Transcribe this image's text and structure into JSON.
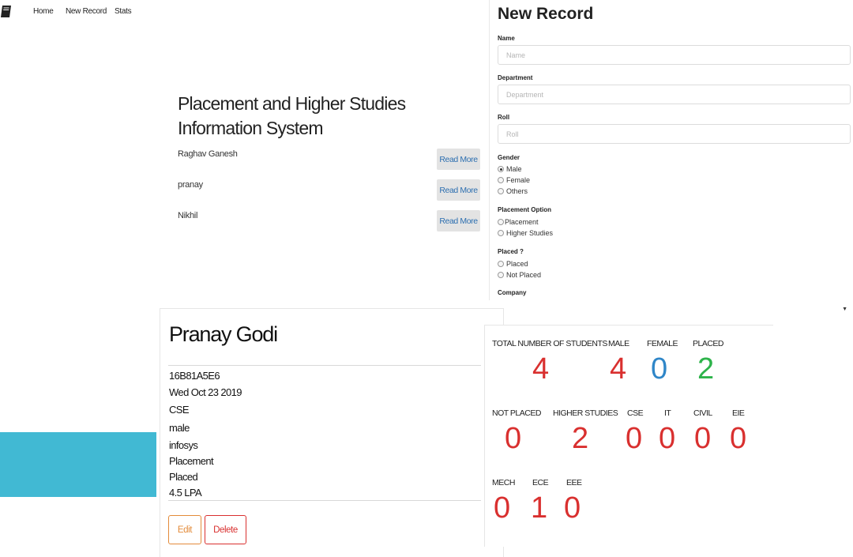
{
  "nav": {
    "logo_icon": "book-icon",
    "links": [
      "Home",
      "New Record",
      "Stats"
    ]
  },
  "main": {
    "title": "Placement and Higher Studies Information System",
    "students": [
      {
        "name": "Raghav Ganesh",
        "action": "Read More"
      },
      {
        "name": "pranay",
        "action": "Read More"
      },
      {
        "name": "Nikhil",
        "action": "Read More"
      }
    ]
  },
  "new_record": {
    "title": "New Record",
    "name_label": "Name",
    "name_placeholder": "Name",
    "department_label": "Department",
    "department_placeholder": "Department",
    "roll_label": "Roll",
    "roll_placeholder": "Roll",
    "gender_label": "Gender",
    "gender_options": [
      "Male",
      "Female",
      "Others"
    ],
    "gender_selected": "Male",
    "placement_option_label": "Placement Option",
    "placement_options": [
      "Placement",
      "Higher Studies"
    ],
    "placed_label": "Placed ?",
    "placed_options": [
      "Placed",
      "Not Placed"
    ],
    "company_label": "Company",
    "company_value": ""
  },
  "detail": {
    "name": "Pranay Godi",
    "lines": [
      "16B81A5E6",
      "Wed Oct 23 2019",
      "CSE",
      "male",
      "infosys",
      "Placement",
      "Placed",
      "4.5 LPA"
    ],
    "edit_label": "Edit",
    "delete_label": "Delete"
  },
  "stats": {
    "rows": [
      [
        {
          "label": "TOTAL NUMBER OF STUDENTS",
          "value": "4",
          "color": "#d9302f"
        },
        {
          "label": "MALE",
          "value": "4",
          "color": "#d9302f"
        },
        {
          "label": "FEMALE",
          "value": "0",
          "color": "#2f86c8"
        },
        {
          "label": "PLACED",
          "value": "2",
          "color": "#2db34a"
        }
      ],
      [
        {
          "label": "NOT PLACED",
          "value": "0",
          "color": "#d9302f"
        },
        {
          "label": "HIGHER STUDIES",
          "value": "2",
          "color": "#d9302f"
        },
        {
          "label": "CSE",
          "value": "0",
          "color": "#d9302f"
        },
        {
          "label": "IT",
          "value": "0",
          "color": "#d9302f"
        },
        {
          "label": "CIVIL",
          "value": "0",
          "color": "#d9302f"
        },
        {
          "label": "EIE",
          "value": "0",
          "color": "#d9302f"
        }
      ],
      [
        {
          "label": "MECH",
          "value": "0",
          "color": "#d9302f"
        },
        {
          "label": "ECE",
          "value": "1",
          "color": "#d9302f"
        },
        {
          "label": "EEE",
          "value": "0",
          "color": "#d9302f"
        }
      ]
    ]
  },
  "colors": {
    "teal_block": "#41b9d3",
    "link_blue": "#2d6fb0",
    "edit_orange": "#e38b3a",
    "delete_red": "#d9302f"
  }
}
